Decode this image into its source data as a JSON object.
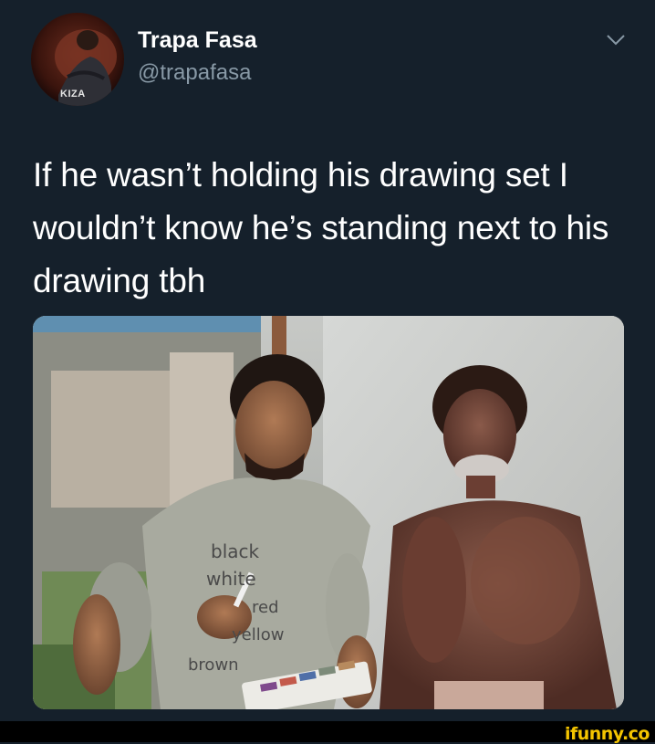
{
  "tweet": {
    "display_name": "Trapa Fasa",
    "handle": "@trapafasa",
    "avatar_badge": "KIZA",
    "text": "If he wasn’t holding his drawing set I wouldn’t know he’s standing next to his drawing tbh",
    "menu_icon": "chevron-down-icon"
  },
  "photo": {
    "shirt_lines": [
      "black",
      "white",
      "red",
      "yellow",
      "brown"
    ]
  },
  "watermark": "ifunny.co",
  "colors": {
    "background": "#15202b",
    "secondary_text": "#8899a6",
    "watermark": "#f4c400"
  }
}
